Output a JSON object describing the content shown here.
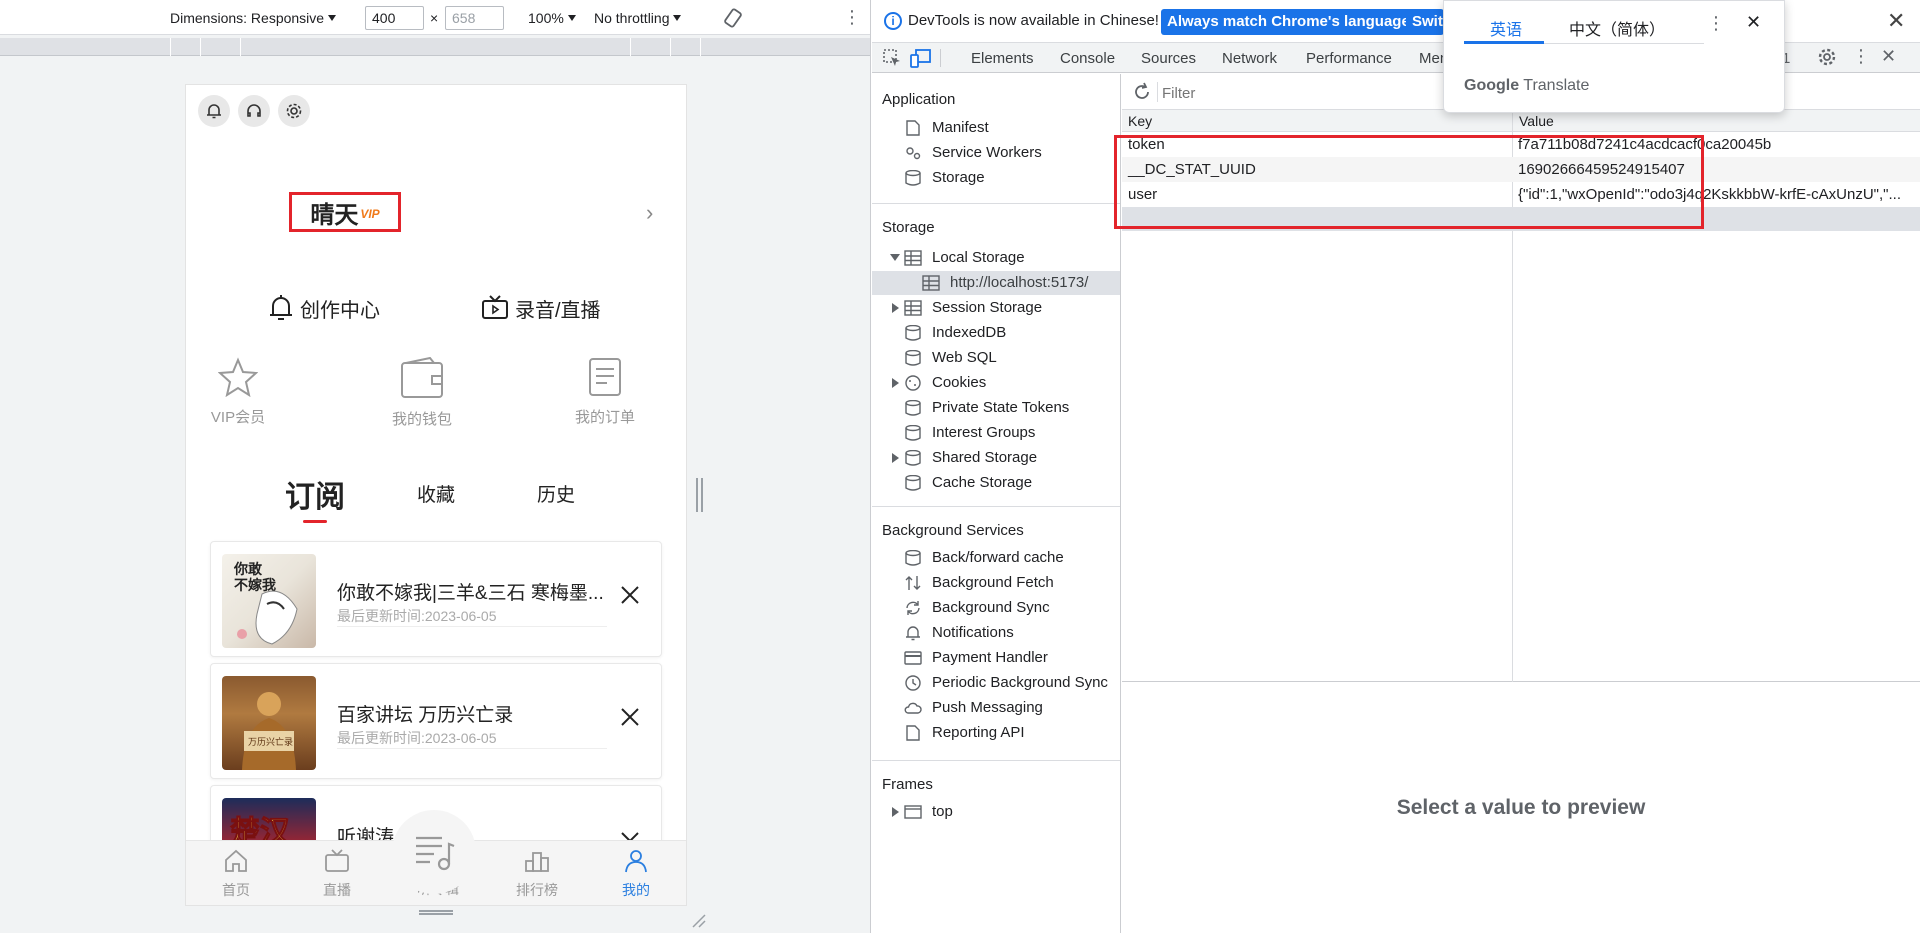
{
  "device_toolbar": {
    "dimensions": "Dimensions: Responsive",
    "width": "400",
    "height": "658",
    "times": "×",
    "zoom": "100%",
    "throttling": "No throttling"
  },
  "app": {
    "profile_name": "晴天",
    "vip_badge": "VIP",
    "features": [
      "创作中心",
      "录音/直播"
    ],
    "mini_links": [
      "VIP会员",
      "我的钱包",
      "我的订单"
    ],
    "tabs": [
      "订阅",
      "收藏",
      "历史"
    ],
    "cards": [
      {
        "title": "你敢不嫁我|三羊&三石 寒梅墨...",
        "meta": "最后更新时间:2023-06-05",
        "cover_text": "你敢不嫁我"
      },
      {
        "title": "百家讲坛 万历兴亡录",
        "meta": "最后更新时间:2023-06-05",
        "cover_text": "万历兴亡录"
      },
      {
        "title": "听谢涛·楚汉录",
        "meta": "",
        "cover_text": "楚汉"
      }
    ],
    "bottom_nav": [
      "首页",
      "直播",
      "听专辑",
      "排行榜",
      "我的"
    ],
    "active_color": "#2b7fe0",
    "accent_red": "#e3242b"
  },
  "devtools": {
    "info_message": "DevTools is now available in Chinese!",
    "info_btn_match": "Always match Chrome's language",
    "info_btn_switch": "Switch DevTools to Chinese",
    "tabs": [
      "Elements",
      "Console",
      "Sources",
      "Network",
      "Performance",
      "Memory"
    ],
    "issues_count": "1",
    "sidebar": {
      "application_title": "Application",
      "application_items": [
        "Manifest",
        "Service Workers",
        "Storage"
      ],
      "storage_title": "Storage",
      "local_storage": "Local Storage",
      "local_storage_origin": "http://localhost:5173/",
      "storage_items": [
        "Session Storage",
        "IndexedDB",
        "Web SQL",
        "Cookies",
        "Private State Tokens",
        "Interest Groups",
        "Shared Storage",
        "Cache Storage"
      ],
      "background_title": "Background Services",
      "background_items": [
        "Back/forward cache",
        "Background Fetch",
        "Background Sync",
        "Notifications",
        "Payment Handler",
        "Periodic Background Sync",
        "Push Messaging",
        "Reporting API"
      ],
      "frames_title": "Frames",
      "frames_items": [
        "top"
      ]
    },
    "filter_placeholder": "Filter",
    "columns": {
      "key": "Key",
      "value": "Value"
    },
    "rows": [
      {
        "key": "token",
        "value": "f7a711b08d7241c4acdcacf0ca20045b"
      },
      {
        "key": "__DC_STAT_UUID",
        "value": "16902666459524915407"
      },
      {
        "key": "user",
        "value": "{\"id\":1,\"wxOpenId\":\"odo3j4q2KskkbbW-krfE-cAxUnzU\",\"..."
      }
    ],
    "preview_text": "Select a value to preview"
  },
  "translate": {
    "lang_en": "英语",
    "lang_zh": "中文（简体）",
    "logo_google": "Google",
    "logo_translate": "Translate"
  }
}
